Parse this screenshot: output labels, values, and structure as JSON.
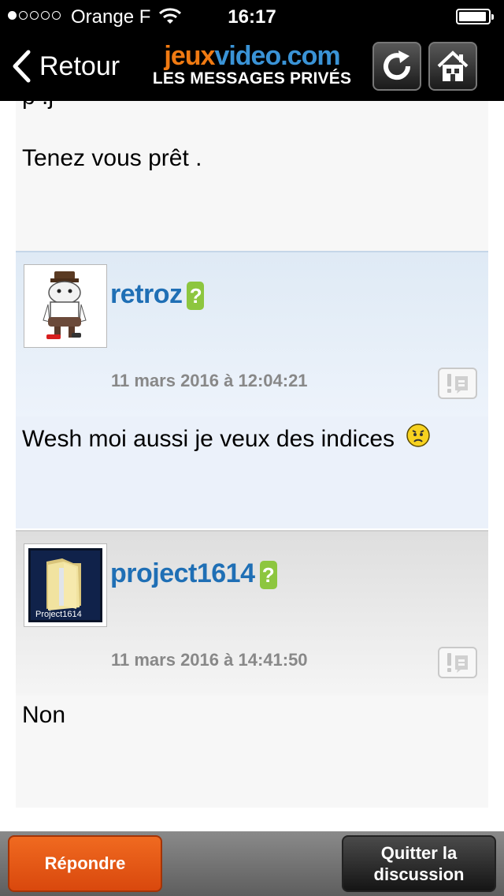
{
  "status_bar": {
    "carrier": "Orange F",
    "time": "16:17",
    "signal_bars_filled": 1,
    "signal_bars_total": 5
  },
  "nav": {
    "back_label": "Retour",
    "logo_part1": "jeux",
    "logo_part2": "video.com",
    "logo_subtitle": "LES MESSAGES PRIVÉS",
    "refresh_icon": "refresh-icon",
    "home_icon": "home-icon"
  },
  "previous_message": {
    "text": "Tenez vous prêt ."
  },
  "messages": [
    {
      "username": "retroz",
      "badge": "?",
      "date": "11 mars 2016 à 12:04:21",
      "body": "Wesh moi aussi je veux des indices",
      "avatar": "retroz-avatar",
      "emoji": "sad-smiley"
    },
    {
      "username": "project1614",
      "badge": "?",
      "date": "11 mars 2016 à 14:41:50",
      "body": "Non",
      "avatar": "folder-avatar",
      "avatar_caption": "Project1614"
    }
  ],
  "bottom": {
    "reply_label": "Répondre",
    "quit_line1": "Quitter la",
    "quit_line2": "discussion"
  },
  "colors": {
    "brand_orange": "#f07a12",
    "brand_blue": "#3a93d6",
    "username_blue": "#1f6fb5",
    "badge_green": "#8dc63f",
    "reply_orange": "#e85a17"
  }
}
